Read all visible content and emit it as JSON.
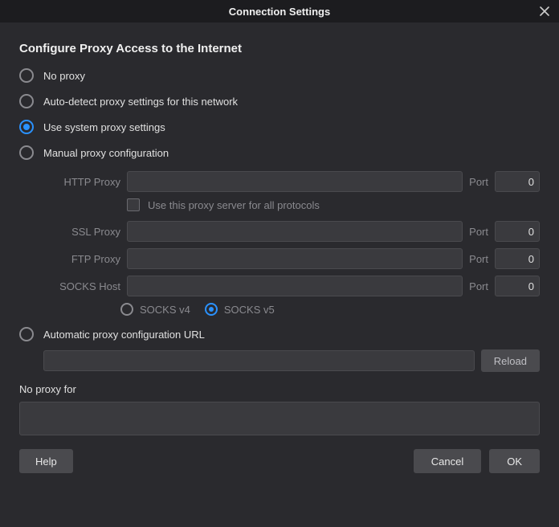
{
  "title": "Connection Settings",
  "heading": "Configure Proxy Access to the Internet",
  "options": {
    "no_proxy": "No proxy",
    "auto_detect": "Auto-detect proxy settings for this network",
    "system": "Use system proxy settings",
    "manual": "Manual proxy configuration",
    "auto_url": "Automatic proxy configuration URL"
  },
  "fields": {
    "http": {
      "label": "HTTP Proxy",
      "value": "",
      "port_label": "Port",
      "port": "0"
    },
    "ssl": {
      "label": "SSL Proxy",
      "value": "",
      "port_label": "Port",
      "port": "0"
    },
    "ftp": {
      "label": "FTP Proxy",
      "value": "",
      "port_label": "Port",
      "port": "0"
    },
    "socks": {
      "label": "SOCKS Host",
      "value": "",
      "port_label": "Port",
      "port": "0"
    }
  },
  "use_all_label": "Use this proxy server for all protocols",
  "socks_versions": {
    "v4": "SOCKS v4",
    "v5": "SOCKS v5"
  },
  "auto_url": {
    "value": "",
    "reload": "Reload"
  },
  "no_proxy_for": {
    "label": "No proxy for",
    "value": ""
  },
  "buttons": {
    "help": "Help",
    "cancel": "Cancel",
    "ok": "OK"
  }
}
